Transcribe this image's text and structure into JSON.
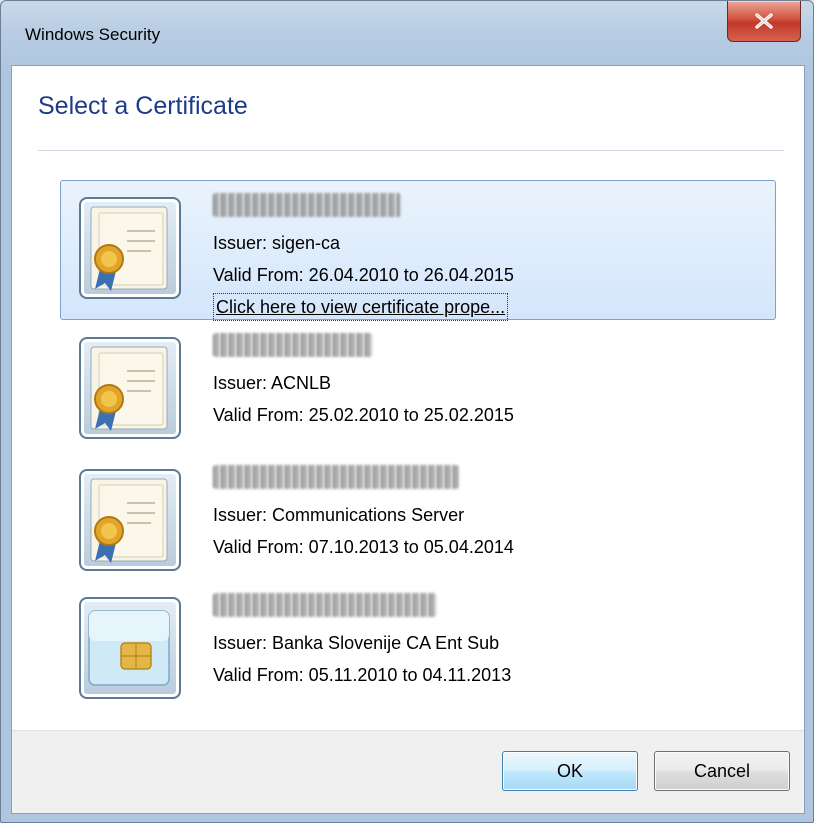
{
  "window": {
    "title": "Windows Security",
    "close_glyph": "x"
  },
  "dialog": {
    "heading": "Select a Certificate"
  },
  "certificates": [
    {
      "issuer": "Issuer: sigen-ca",
      "valid": "Valid From: 26.04.2010 to 26.04.2015",
      "link": "Click here to view certificate prope...",
      "icon": "certificate-icon",
      "selected": true
    },
    {
      "issuer": "Issuer: ACNLB",
      "valid": "Valid From: 25.02.2010 to 25.02.2015",
      "icon": "certificate-icon",
      "selected": false
    },
    {
      "issuer": "Issuer: Communications Server",
      "valid": "Valid From: 07.10.2013 to 05.04.2014",
      "icon": "certificate-icon",
      "selected": false
    },
    {
      "issuer": "Issuer: Banka Slovenije CA Ent Sub",
      "valid": "Valid From: 05.11.2010 to 04.11.2013",
      "icon": "smart-card-icon",
      "selected": false
    }
  ],
  "buttons": {
    "ok": "OK",
    "cancel": "Cancel"
  },
  "colors": {
    "heading": "#1e3b8a",
    "selection_bg": "#d4e6fb",
    "selection_border": "#7da2ce",
    "close_red": "#c0392b"
  }
}
